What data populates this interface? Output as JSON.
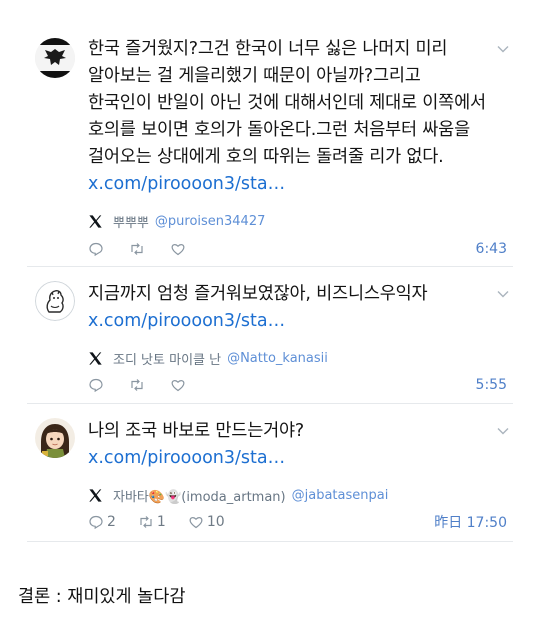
{
  "posts": [
    {
      "text": "한국 즐거웠지?그건 한국이 너무 싫은 나머지 미리 알아보는 걸 게을리했기 때문이 아닐까?그리고 한국인이 반일이 아닌 것에 대해서인데 제대로 이쪽에서 호의를 보이면 호의가 돌아온다.그런 처음부터 싸움을 걸어오는 상대에게 호의 따위는 돌려줄 리가 없다.",
      "link": "x.com/piroooon3/sta…",
      "display_name": "뿌뿌뿌",
      "handle": "@puroisen34427",
      "reply_count": "",
      "repost_count": "",
      "like_count": "",
      "time": "6:43",
      "avatar_icon": "prussian-eagle-flag-avatar"
    },
    {
      "text": "지금까지 엄청 즐거워보였잖아, 비즈니스우익자",
      "link": "x.com/piroooon3/sta…",
      "display_name": "조디 낫토 마이클 난",
      "handle": "@Natto_kanasii",
      "reply_count": "",
      "repost_count": "",
      "like_count": "",
      "time": "5:55",
      "avatar_icon": "sketch-animal-avatar"
    },
    {
      "text": "나의 조국 바보로 만드는거야?",
      "link": "x.com/piroooon3/sta…",
      "display_name": "자바타🎨👻(imoda_artman)",
      "handle": "@jabatasenpai",
      "reply_count": "2",
      "repost_count": "1",
      "like_count": "10",
      "time": "昨日 17:50",
      "avatar_icon": "anime-girl-avatar"
    }
  ],
  "caption": "결론 : 재미있게 놀다감",
  "colors": {
    "link": "#1d6fd1",
    "handle": "#5e8fd6",
    "muted": "#6f7b86",
    "divider": "#e6e9ec"
  }
}
